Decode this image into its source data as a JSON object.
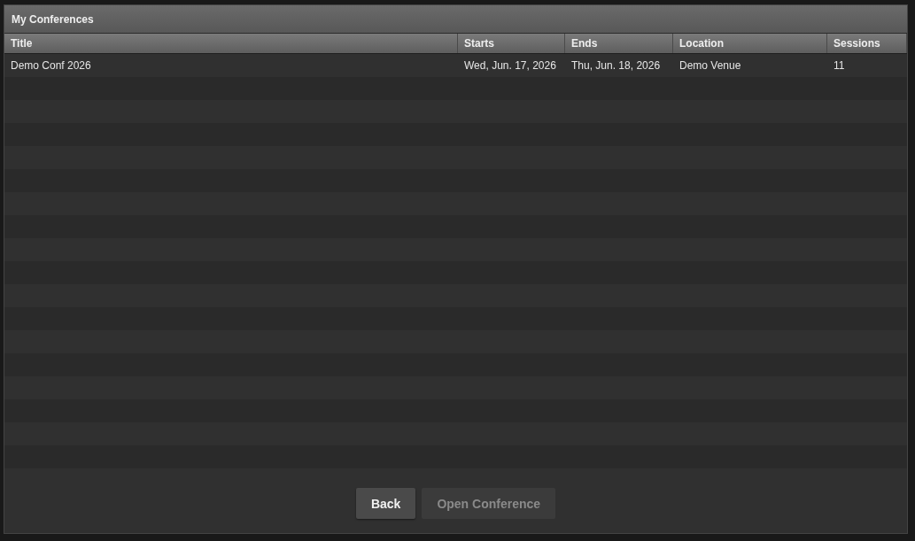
{
  "window": {
    "title": "My Conferences"
  },
  "table": {
    "columns": [
      "Title",
      "Starts",
      "Ends",
      "Location",
      "Sessions"
    ],
    "rows": [
      {
        "cells": [
          "Demo Conf 2026",
          "Wed, Jun. 17, 2026",
          "Thu, Jun. 18, 2026",
          "Demo Venue",
          "11"
        ]
      }
    ]
  },
  "buttons": [
    {
      "label": "Back",
      "disabled": false
    },
    {
      "label": "Open Conference",
      "disabled": true
    }
  ]
}
